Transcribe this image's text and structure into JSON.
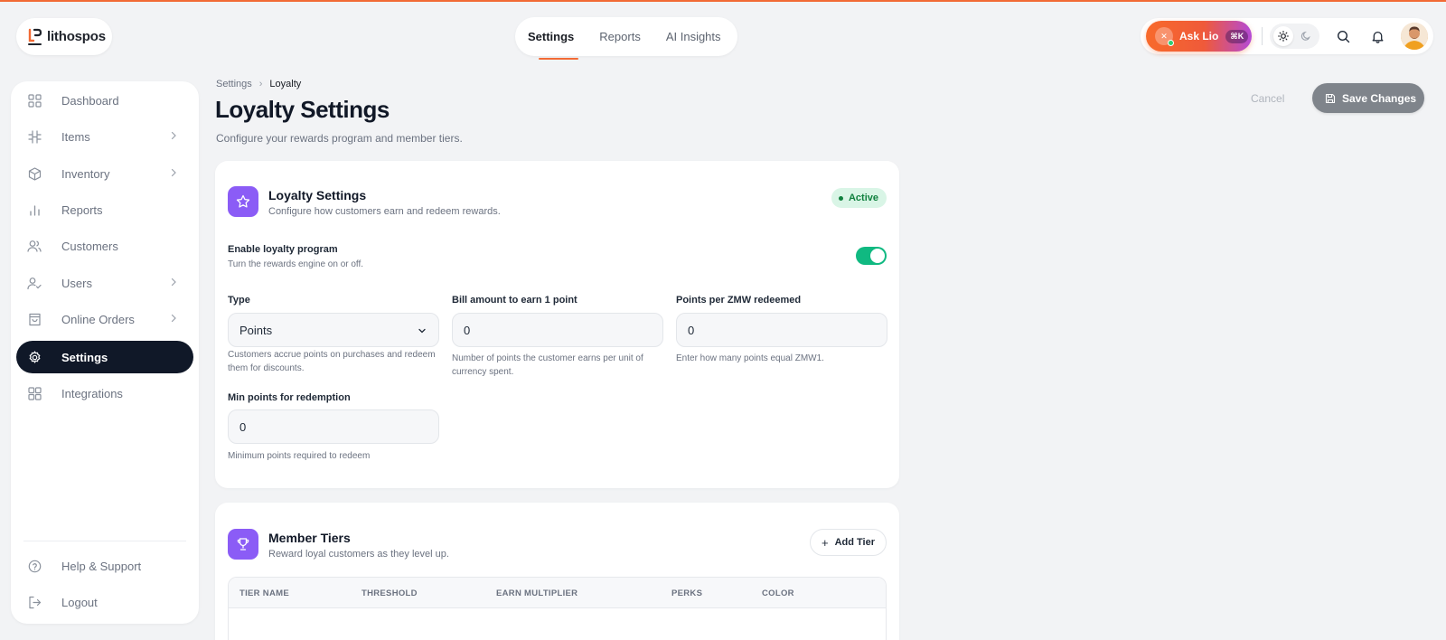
{
  "brand": {
    "name": "lithospos",
    "accent": "#f26a35"
  },
  "topnav": {
    "tabs": [
      {
        "label": "Settings",
        "active": true
      },
      {
        "label": "Reports",
        "active": false
      },
      {
        "label": "AI Insights",
        "active": false
      }
    ]
  },
  "header": {
    "ask_label": "Ask Lio",
    "ask_shortcut": "⌘K",
    "icons": [
      "sun-icon",
      "moon-icon",
      "search-icon",
      "bell-icon",
      "avatar"
    ]
  },
  "sidebar": {
    "items": [
      {
        "label": "Dashboard",
        "icon": "grid-icon",
        "has_chevron": false,
        "active": false
      },
      {
        "label": "Items",
        "icon": "items-icon",
        "has_chevron": true,
        "active": false
      },
      {
        "label": "Inventory",
        "icon": "box-icon",
        "has_chevron": true,
        "active": false
      },
      {
        "label": "Reports",
        "icon": "bar-chart-icon",
        "has_chevron": false,
        "active": false
      },
      {
        "label": "Customers",
        "icon": "users-icon",
        "has_chevron": false,
        "active": false
      },
      {
        "label": "Users",
        "icon": "user-check-icon",
        "has_chevron": true,
        "active": false
      },
      {
        "label": "Online Orders",
        "icon": "shopping-bag-icon",
        "has_chevron": true,
        "active": false
      },
      {
        "label": "Settings",
        "icon": "gear-icon",
        "has_chevron": false,
        "active": true
      },
      {
        "label": "Integrations",
        "icon": "integrations-icon",
        "has_chevron": false,
        "active": false
      }
    ],
    "footer": [
      {
        "label": "Help & Support",
        "icon": "help-icon"
      },
      {
        "label": "Logout",
        "icon": "logout-icon"
      }
    ]
  },
  "breadcrumb": {
    "parent": "Settings",
    "current": "Loyalty"
  },
  "page": {
    "title": "Loyalty Settings",
    "subtitle": "Configure your rewards program and member tiers.",
    "cancel_label": "Cancel",
    "save_label": "Save Changes"
  },
  "loyalty_card": {
    "title": "Loyalty Settings",
    "subtitle": "Configure how customers earn and redeem rewards.",
    "status": "Active",
    "enable_label": "Enable loyalty program",
    "enable_help": "Turn the rewards engine on or off.",
    "enabled": true,
    "type": {
      "label": "Type",
      "value": "Points",
      "help": "Customers accrue points on purchases and redeem them for discounts."
    },
    "bill_amount": {
      "label": "Bill amount to earn 1 point",
      "value": "0",
      "help": "Number of points the customer earns per unit of currency spent."
    },
    "points_per": {
      "label": "Points per ZMW redeemed",
      "value": "0",
      "help": "Enter how many points equal ZMW1."
    },
    "min_points": {
      "label": "Min points for redemption",
      "value": "0",
      "help": "Minimum points required to redeem"
    }
  },
  "tiers_card": {
    "title": "Member Tiers",
    "subtitle": "Reward loyal customers as they level up.",
    "add_label": "Add Tier",
    "columns": [
      "TIER NAME",
      "THRESHOLD",
      "EARN MULTIPLIER",
      "PERKS",
      "COLOR"
    ]
  },
  "colors": {
    "sidebar_active": "#101828",
    "card_icon": "#8b5cf6",
    "toggle_on": "#10b981",
    "badge_bg": "#d9f5e6"
  }
}
